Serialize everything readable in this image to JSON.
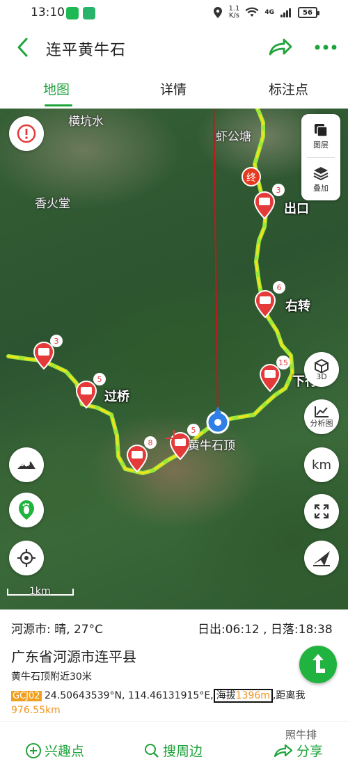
{
  "status_bar": {
    "time": "13:10",
    "speed_value": "1.1",
    "speed_unit": "K/s",
    "network": "4G",
    "battery": "56"
  },
  "header": {
    "title": "连平黄牛石",
    "back_icon": "chevron-left-icon",
    "share_icon": "share-arrow-icon",
    "more_icon": "more-dots-icon",
    "accent_color": "#1fa33b"
  },
  "tabs": [
    {
      "label": "地图",
      "active": true
    },
    {
      "label": "详情",
      "active": false
    },
    {
      "label": "标注点",
      "active": false
    }
  ],
  "map": {
    "place_labels": [
      "横坑水",
      "虾公塘",
      "香火堂",
      "黄牛石顶"
    ],
    "trail_labels": [
      "出口",
      "右转",
      "下行",
      "过桥"
    ],
    "end_marker": "终",
    "photo_pins": [
      {
        "count": "3"
      },
      {
        "count": "6"
      },
      {
        "count": "15"
      },
      {
        "count": "3"
      },
      {
        "count": "5"
      },
      {
        "count": "8"
      },
      {
        "count": "5"
      }
    ],
    "layers_label": "图层",
    "overlay_label": "叠加",
    "btn_3d_label": "3D",
    "analysis_label": "分析图",
    "km_label": "km",
    "scale_label": "1km",
    "track_color": "#f2e31a",
    "track_secondary_color": "#9be83a"
  },
  "info": {
    "weather": "河源市: 晴, 27°C",
    "sun": "日出:06:12 , 日落:18:38",
    "region": "广东省河源市连平县",
    "nearby": "黄牛石顶附近30米",
    "coord_system": "GCJ02",
    "lat": "24.50643539°N",
    "lon": "114.46131915°E",
    "alt_label": "海拔",
    "alt_value": "1396m",
    "dist_label": "距离我",
    "dist_value": "976.55km"
  },
  "bottom_bar": {
    "poi": "兴趣点",
    "search": "搜周边",
    "share": "分享",
    "watermark": "照牛排"
  }
}
